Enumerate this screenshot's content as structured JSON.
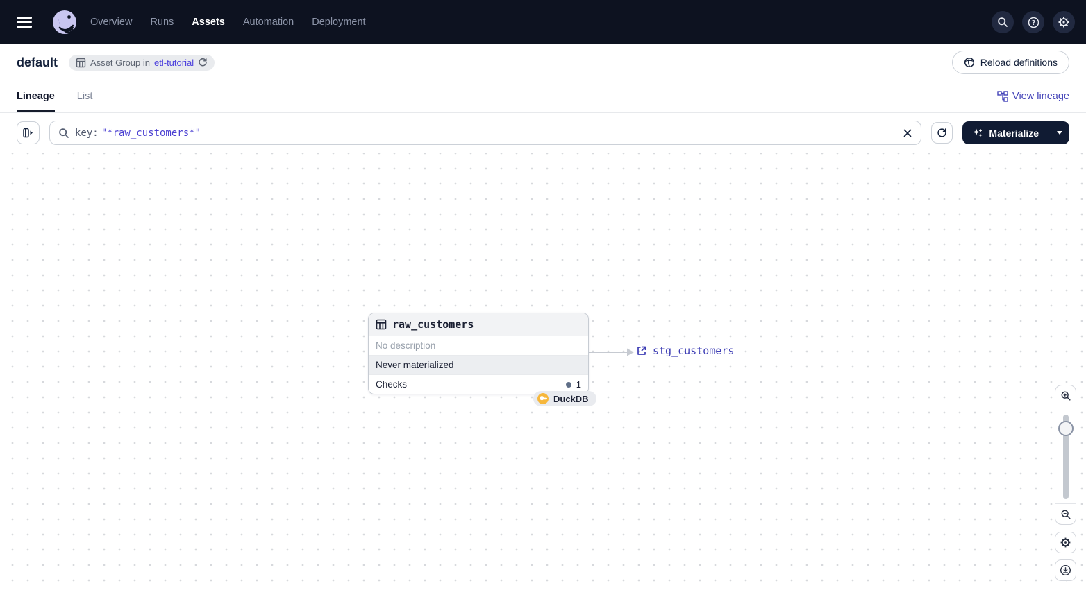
{
  "topnav": {
    "items": [
      "Overview",
      "Runs",
      "Assets",
      "Automation",
      "Deployment"
    ],
    "active_item": "Assets"
  },
  "header": {
    "title": "default",
    "badge_prefix": "Asset Group in",
    "badge_link": "etl-tutorial",
    "reload_button": "Reload definitions"
  },
  "tabs": {
    "lineage": "Lineage",
    "list": "List",
    "view_lineage": "View lineage"
  },
  "toolbar": {
    "filter_key": "key:",
    "filter_value": "\"*raw_customers*\"",
    "materialize": "Materialize"
  },
  "graph": {
    "node": {
      "title": "raw_customers",
      "description": "No description",
      "status": "Never materialized",
      "checks_label": "Checks",
      "checks_count": "1",
      "kind": "DuckDB"
    },
    "downstream_asset": "stg_customers"
  },
  "colors": {
    "topbar_bg": "#0d1220",
    "link_purple": "#4f43dd",
    "lineage_link": "#3d3db5",
    "materialize_bg": "#101b33",
    "duckdb_yellow": "#f6b73c",
    "status_row_bg": "#eceef1"
  }
}
